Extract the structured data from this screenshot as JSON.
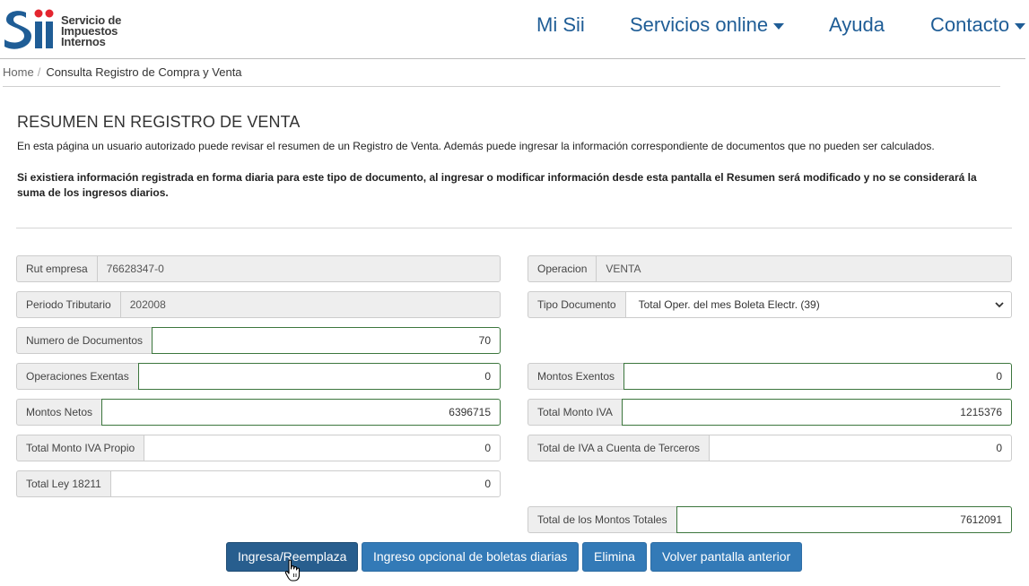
{
  "header": {
    "logo_lines": [
      "Servicio de",
      "Impuestos",
      "Internos"
    ],
    "nav": [
      {
        "label": "Mi Sii"
      },
      {
        "label": "Servicios online"
      },
      {
        "label": "Ayuda"
      },
      {
        "label": "Contacto"
      }
    ]
  },
  "breadcrumb": {
    "home": "Home",
    "sep": "/",
    "current": "Consulta Registro de Compra y Venta"
  },
  "page": {
    "title": "RESUMEN EN REGISTRO DE VENTA",
    "description": "En esta página un usuario autorizado puede revisar el resumen de un Registro de Venta. Además puede ingresar la información correspondiente de documentos que no pueden ser calculados.",
    "warning": "Si existiera información registrada en forma diaria para este tipo de documento, al ingresar o modificar información desde esta pantalla el Resumen será modificado y no se considerará la suma de los ingresos diarios."
  },
  "form": {
    "rut": {
      "label": "Rut empresa",
      "value": "76628347-0"
    },
    "operacion": {
      "label": "Operacion",
      "value": "VENTA"
    },
    "periodo": {
      "label": "Periodo Tributario",
      "value": "202008"
    },
    "tipo_doc": {
      "label": "Tipo Documento",
      "value": "Total Oper. del mes Boleta Electr. (39)"
    },
    "num_docs": {
      "label": "Numero de Documentos",
      "value": "70"
    },
    "op_exentas": {
      "label": "Operaciones Exentas",
      "value": "0"
    },
    "montos_exentos": {
      "label": "Montos Exentos",
      "value": "0"
    },
    "montos_netos": {
      "label": "Montos Netos",
      "value": "6396715"
    },
    "total_iva": {
      "label": "Total Monto IVA",
      "value": "1215376"
    },
    "iva_propio": {
      "label": "Total Monto IVA Propio",
      "value": "0"
    },
    "iva_terceros": {
      "label": "Total de IVA a Cuenta de Terceros",
      "value": "0"
    },
    "ley_18211": {
      "label": "Total Ley 18211",
      "value": "0"
    },
    "montos_totales": {
      "label": "Total de los Montos Totales",
      "value": "7612091"
    }
  },
  "buttons": {
    "ingresa": "Ingresa/Reemplaza",
    "opcional": "Ingreso opcional de boletas diarias",
    "elimina": "Elimina",
    "volver": "Volver pantalla anterior"
  },
  "colors": {
    "brand": "#1f5d96",
    "primary": "#337ab7",
    "valid_border": "#3c763d"
  }
}
